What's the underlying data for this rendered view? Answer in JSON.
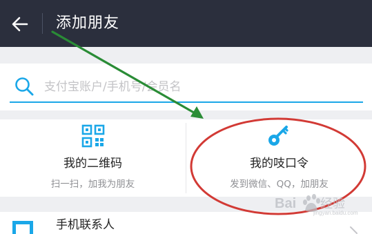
{
  "header": {
    "title": "添加朋友",
    "back_icon": "arrow-left-icon",
    "background": "#2b2f3d"
  },
  "search": {
    "placeholder": "支付宝账户/手机号/会员名",
    "icon": "search-icon",
    "accent": "#1aa7e8"
  },
  "cards": [
    {
      "title": "我的二维码",
      "subtitle": "扫一扫，加我为朋友",
      "icon": "qr-code-icon"
    },
    {
      "title": "我的吱口令",
      "subtitle": "发到微信、QQ，加朋友",
      "icon": "key-icon"
    }
  ],
  "list": [
    {
      "label": "手机联系人",
      "icon": "phone-contacts-icon"
    }
  ],
  "colors": {
    "icon_blue": "#1aa7e8",
    "annotation_arrow": "#2a8c36",
    "annotation_circle": "#d23a35"
  }
}
